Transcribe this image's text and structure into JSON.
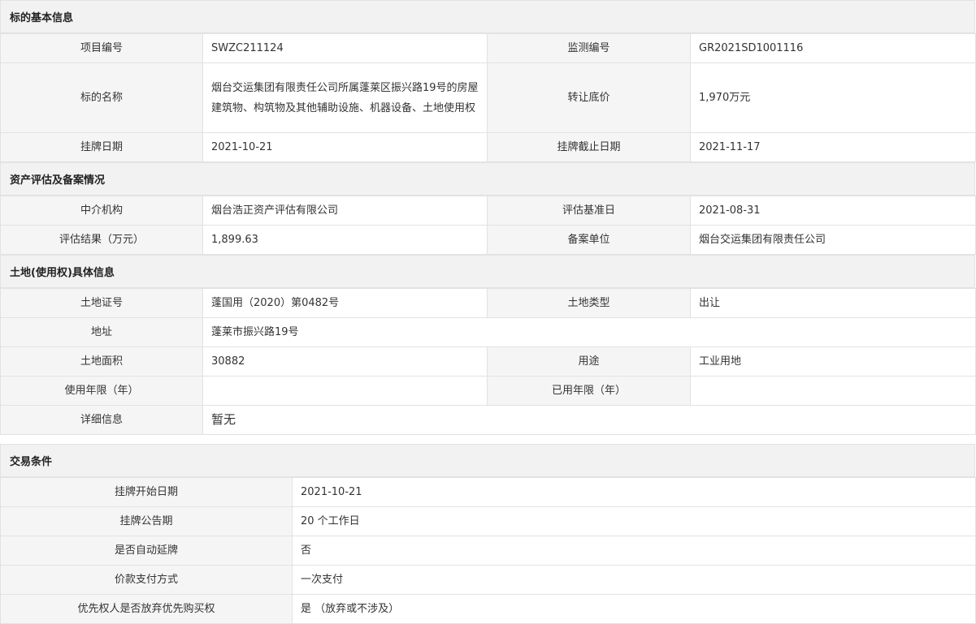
{
  "basic": {
    "title": "标的基本信息",
    "project_no_label": "项目编号",
    "project_no": "SWZC211124",
    "monitor_no_label": "监测编号",
    "monitor_no": "GR2021SD1001116",
    "name_label": "标的名称",
    "name": "烟台交运集团有限责任公司所属蓬莱区振兴路19号的房屋建筑物、构筑物及其他辅助设施、机器设备、土地使用权",
    "floor_price_label": "转让底价",
    "floor_price": "1,970万元",
    "list_date_label": "挂牌日期",
    "list_date": "2021-10-21",
    "list_end_label": "挂牌截止日期",
    "list_end": "2021-11-17"
  },
  "assessment": {
    "title": "资产评估及备案情况",
    "agency_label": "中介机构",
    "agency": "烟台浩正资产评估有限公司",
    "base_date_label": "评估基准日",
    "base_date": "2021-08-31",
    "result_label": "评估结果（万元）",
    "result": "1,899.63",
    "filing_unit_label": "备案单位",
    "filing_unit": "烟台交运集团有限责任公司"
  },
  "land": {
    "title": "土地(使用权)具体信息",
    "cert_label": "土地证号",
    "cert": "蓬国用（2020）第0482号",
    "type_label": "土地类型",
    "type": "出让",
    "address_label": "地址",
    "address": "蓬莱市振兴路19号",
    "area_label": "土地面积",
    "area": "30882",
    "use_label": "用途",
    "use": "工业用地",
    "years_label": "使用年限（年）",
    "years": "",
    "used_years_label": "已用年限（年）",
    "used_years": "",
    "detail_label": "详细信息",
    "detail": "暂无"
  },
  "trade": {
    "title": "交易条件",
    "rows": [
      {
        "label": "挂牌开始日期",
        "value": "2021-10-21"
      },
      {
        "label": "挂牌公告期",
        "value": "20 个工作日"
      },
      {
        "label": "是否自动延牌",
        "value": "否"
      },
      {
        "label": "价款支付方式",
        "value": "一次支付"
      },
      {
        "label": "优先权人是否放弃优先购买权",
        "value": "是 （放弃或不涉及）"
      }
    ]
  }
}
